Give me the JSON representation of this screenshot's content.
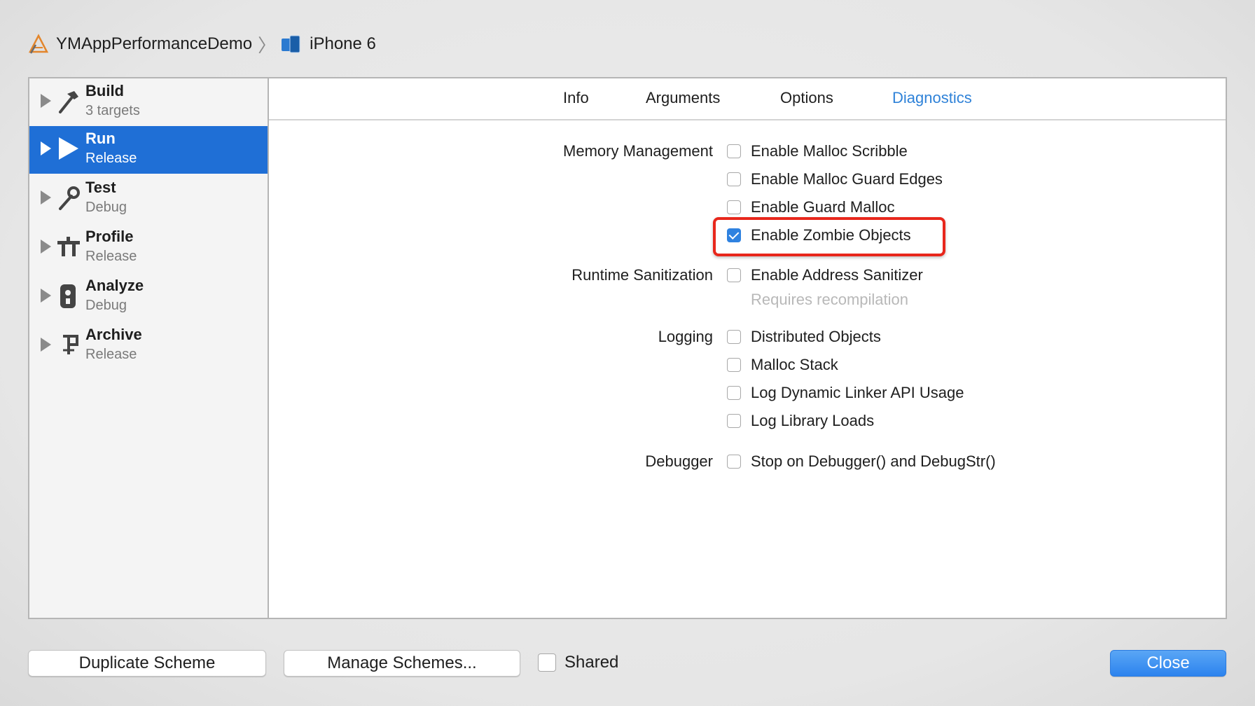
{
  "breadcrumb": {
    "project": "YMAppPerformanceDemo",
    "separator": "〉",
    "device": "iPhone 6"
  },
  "sidebar": {
    "actions": [
      {
        "name": "Build",
        "sub": "3 targets",
        "icon": "hammer-icon"
      },
      {
        "name": "Run",
        "sub": "Release",
        "icon": "play-icon",
        "selected": true
      },
      {
        "name": "Test",
        "sub": "Debug",
        "icon": "wrench-icon"
      },
      {
        "name": "Profile",
        "sub": "Release",
        "icon": "instruments-icon"
      },
      {
        "name": "Analyze",
        "sub": "Debug",
        "icon": "analyze-icon"
      },
      {
        "name": "Archive",
        "sub": "Release",
        "icon": "archive-icon"
      }
    ]
  },
  "tabs": [
    "Info",
    "Arguments",
    "Options",
    "Diagnostics"
  ],
  "active_tab": "Diagnostics",
  "sections": {
    "memory_management": {
      "label": "Memory Management",
      "options": [
        {
          "label": "Enable Malloc Scribble",
          "checked": false
        },
        {
          "label": "Enable Malloc Guard Edges",
          "checked": false
        },
        {
          "label": "Enable Guard Malloc",
          "checked": false
        },
        {
          "label": "Enable Zombie Objects",
          "checked": true
        }
      ]
    },
    "runtime_sanitization": {
      "label": "Runtime Sanitization",
      "options": [
        {
          "label": "Enable Address Sanitizer",
          "checked": false
        }
      ],
      "hint": "Requires recompilation"
    },
    "logging": {
      "label": "Logging",
      "options": [
        {
          "label": "Distributed Objects",
          "checked": false
        },
        {
          "label": "Malloc Stack",
          "checked": false
        },
        {
          "label": "Log Dynamic Linker API Usage",
          "checked": false
        },
        {
          "label": "Log Library Loads",
          "checked": false
        }
      ]
    },
    "debugger": {
      "label": "Debugger",
      "options": [
        {
          "label": "Stop on Debugger() and DebugStr()",
          "checked": false
        }
      ]
    }
  },
  "footer": {
    "duplicate": "Duplicate Scheme",
    "manage": "Manage Schemes...",
    "shared": "Shared",
    "shared_checked": false,
    "close": "Close"
  },
  "colors": {
    "selection": "#1f6fd6",
    "accent": "#2f82d8",
    "highlight": "#e8271c"
  }
}
